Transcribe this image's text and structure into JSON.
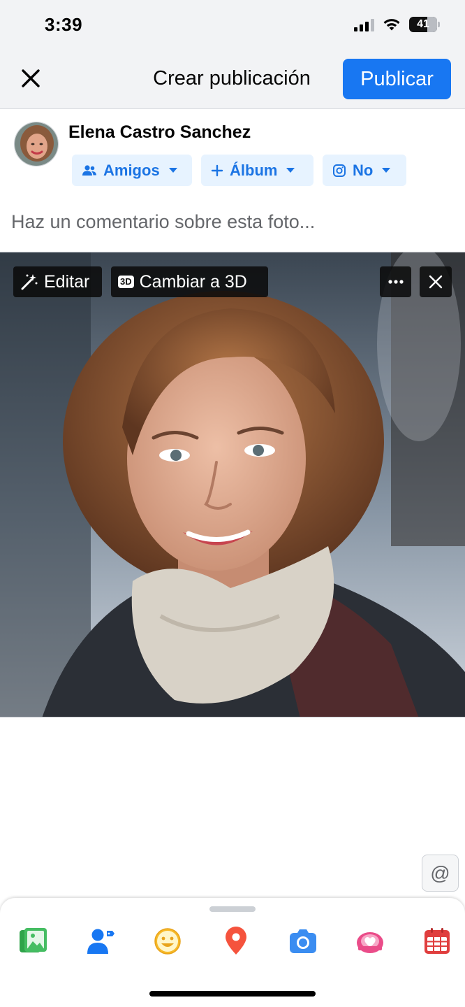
{
  "status_bar": {
    "time": "3:39",
    "battery": "41"
  },
  "header": {
    "title": "Crear publicación",
    "publish_label": "Publicar"
  },
  "composer": {
    "user_name": "Elena Castro Sanchez",
    "audience_label": "Amigos",
    "album_label": "Álbum",
    "instagram_label": "No",
    "comment_placeholder": "Haz un comentario sobre esta foto..."
  },
  "photo": {
    "edit_label": "Editar",
    "three_d_badge": "3D",
    "three_d_label": "Cambiar a 3D"
  },
  "mention": {
    "symbol": "@"
  },
  "toolbar": {
    "icons": [
      "photo-video-icon",
      "tag-people-icon",
      "feeling-icon",
      "check-in-icon",
      "camera-icon",
      "support-nonprofit-icon",
      "event-icon"
    ]
  },
  "colors": {
    "brand_blue": "#1877f2",
    "pill_bg": "#e7f3ff",
    "pill_text": "#1b74e4"
  }
}
